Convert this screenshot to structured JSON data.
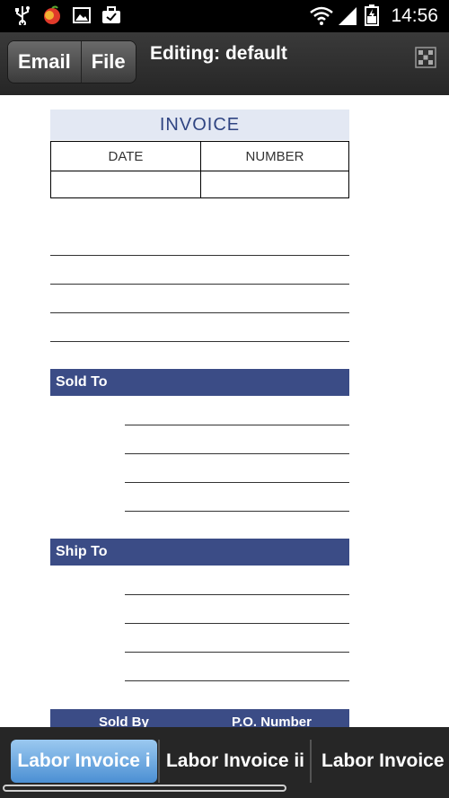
{
  "status_bar": {
    "time": "14:56",
    "icons": [
      "usb-icon",
      "app-notification-icon",
      "image-icon",
      "briefcase-check-icon",
      "wifi-icon",
      "signal-icon",
      "battery-icon"
    ]
  },
  "action_bar": {
    "buttons": [
      "Email",
      "File"
    ],
    "title": "Editing: default",
    "right_icon": "grid-pattern-icon"
  },
  "invoice": {
    "title": "INVOICE",
    "columns": [
      "DATE",
      "NUMBER"
    ],
    "sections": [
      "Sold To",
      "Ship To"
    ],
    "footer_columns": [
      "Sold By",
      "P.O. Number"
    ]
  },
  "tabs": {
    "items": [
      "Labor Invoice i",
      "Labor Invoice ii",
      "Labor Invoice"
    ],
    "selected": "Labor Invoice i"
  },
  "colors": {
    "accent": "#3b4c86",
    "title_bg": "#e3e8f3",
    "title_text": "#2f4482",
    "tab_active": "#6aa9e2"
  }
}
